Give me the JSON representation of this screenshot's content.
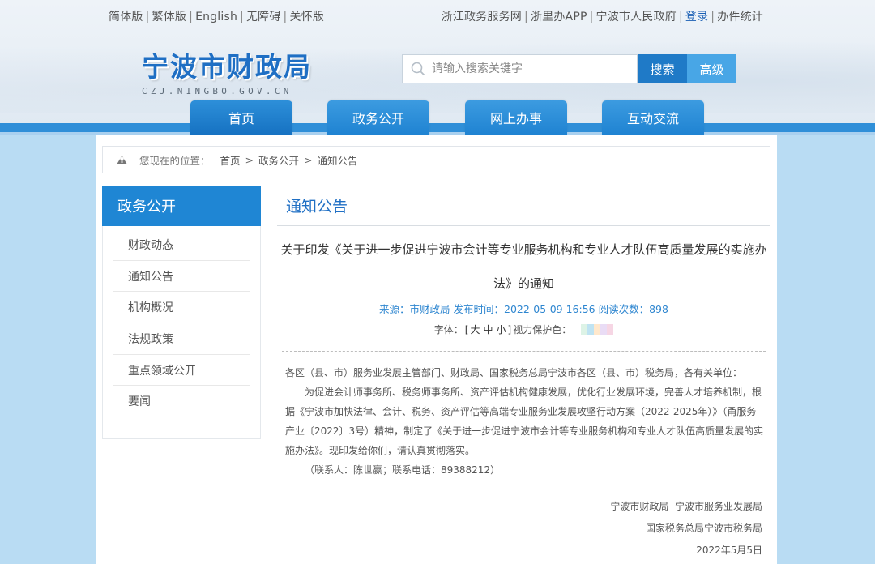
{
  "top_left_links": [
    "简体版",
    "繁体版",
    "English",
    "无障碍",
    "关怀版"
  ],
  "top_right_links": [
    "浙江政务服务网",
    "浙里办APP",
    "宁波市人民政府",
    "登录",
    "办件统计"
  ],
  "logo": {
    "title": "宁波市财政局",
    "subtitle": "CZJ.NINGBO.GOV.CN"
  },
  "search": {
    "placeholder": "请输入搜索关键字",
    "search_label": "搜索",
    "advanced_label": "高级"
  },
  "nav": [
    "首页",
    "政务公开",
    "网上办事",
    "互动交流"
  ],
  "breadcrumb": {
    "lead": "您现在的位置：",
    "items": [
      "首页",
      "政务公开",
      "通知公告"
    ],
    "separator": ">"
  },
  "sidebar": {
    "heading": "政务公开",
    "items": [
      "财政动态",
      "通知公告",
      "机构概况",
      "法规政策",
      "重点领域公开",
      "要闻"
    ]
  },
  "section_title": "通知公告",
  "article": {
    "title_line1": "关于印发《关于进一步促进宁波市会计等专业服务机构和专业人才队伍高质量发展的实施办",
    "title_line2": "法》的通知",
    "meta": "来源：市财政局 发布时间：2022-05-09 16:56 阅读次数：898",
    "font_label": "字体：",
    "font_sizes": [
      "大",
      "中",
      "小"
    ],
    "vision_label": "视力保护色：",
    "swatch_colors": [
      "#ffffff",
      "#ddf3e6",
      "#bfe3f2",
      "#ffe8cc",
      "#e9dcf5",
      "#f6d6e4"
    ],
    "salutation": "各区（县、市）服务业发展主管部门、财政局、国家税务总局宁波市各区（县、市）税务局，各有关单位：",
    "paragraph": "为促进会计师事务所、税务师事务所、资产评估机构健康发展，优化行业发展环境，完善人才培养机制，根据《宁波市加快法律、会计、税务、资产评估等高端专业服务业发展攻坚行动方案（2022-2025年）》（甬服务产业〔2022〕3号）精神，制定了《关于进一步促进宁波市会计等专业服务机构和专业人才队伍高质量发展的实施办法》。现印发给你们，请认真贯彻落实。",
    "contact": "（联系人：陈世赢；联系电话：89388212）",
    "signature": [
      "宁波市财政局  宁波市服务业发展局",
      "国家税务总局宁波市税务局",
      "2022年5月5日"
    ]
  }
}
